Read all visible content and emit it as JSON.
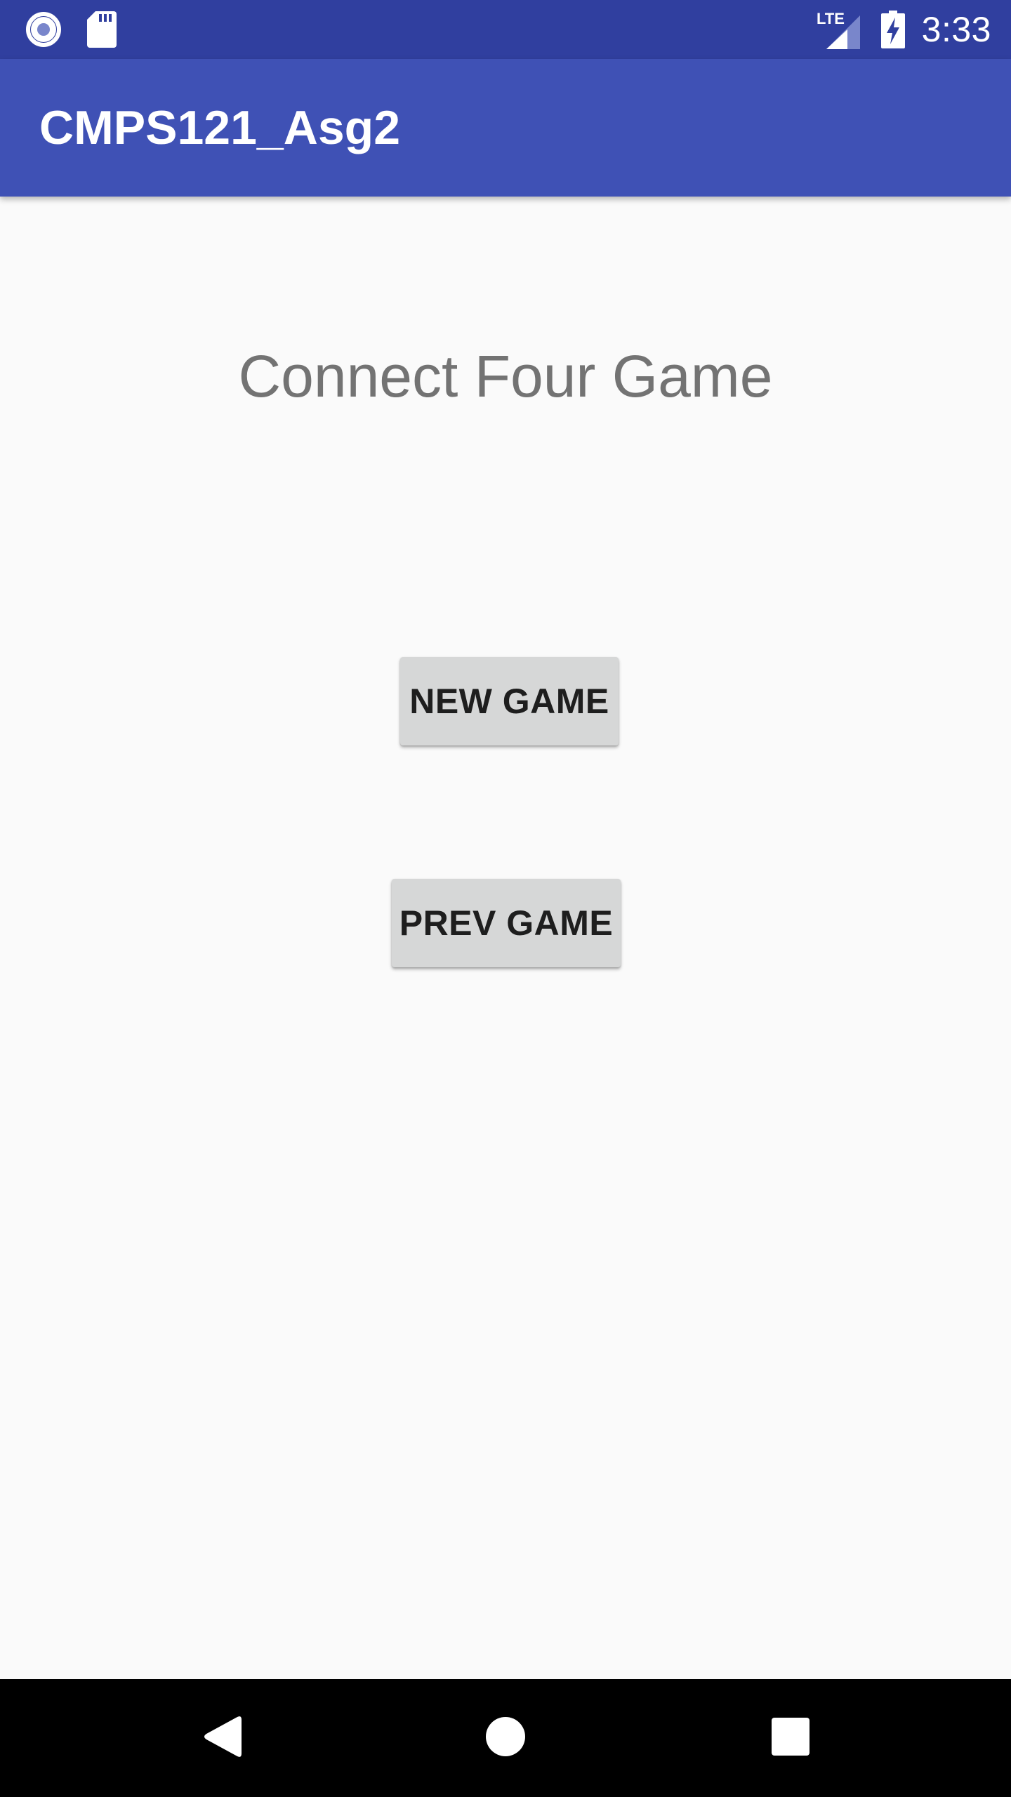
{
  "status_bar": {
    "time": "3:33",
    "network_label": "LTE",
    "icons": [
      "notification-dot-icon",
      "sd-card-icon",
      "lte-signal-icon",
      "battery-charging-icon"
    ]
  },
  "app_bar": {
    "title": "CMPS121_Asg2"
  },
  "main": {
    "headline": "Connect Four Game",
    "new_game_label": "NEW GAME",
    "prev_game_label": "PREV GAME"
  },
  "nav_bar": {
    "icons": [
      "back-icon",
      "home-icon",
      "recents-icon"
    ]
  },
  "colors": {
    "status_bar": "#303f9f",
    "app_bar": "#3f51b5",
    "background": "#fafafa",
    "button": "#d6d7d7",
    "headline_text": "#737373",
    "nav_bar": "#000000"
  }
}
